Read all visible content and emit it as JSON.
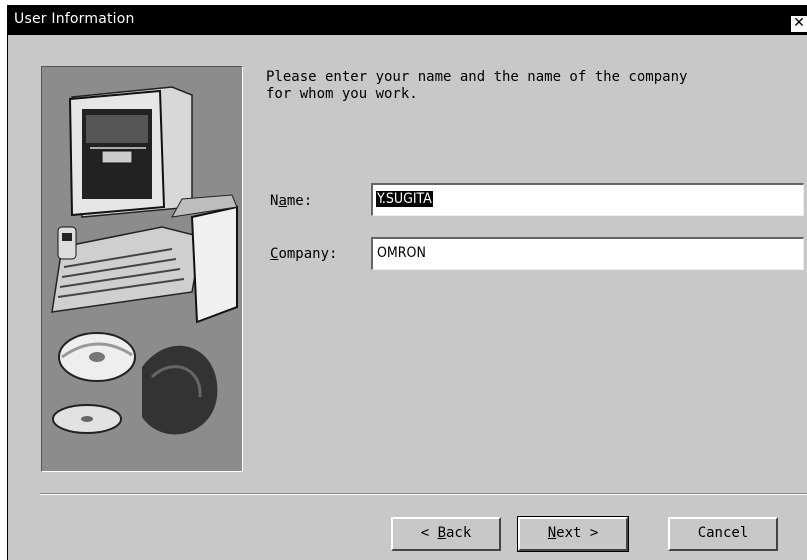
{
  "window": {
    "title": "User Information",
    "close_label": "✕"
  },
  "prompt": {
    "line1": "Please enter your name and the name of the company",
    "line2": "for whom you work."
  },
  "fields": {
    "name": {
      "label_pre": "N",
      "label_mnemonic": "a",
      "label_post": "me:",
      "value": "Y.SUGITA"
    },
    "company": {
      "label_mnemonic": "C",
      "label_post": "ompany:",
      "value": "OMRON"
    }
  },
  "buttons": {
    "back": {
      "pre": "< ",
      "mnemonic": "B",
      "post": "ack"
    },
    "next": {
      "mnemonic": "N",
      "post": "ext >"
    },
    "cancel": {
      "label": "Cancel"
    }
  },
  "illustration": {
    "icon": "computer-and-cds-illustration"
  }
}
